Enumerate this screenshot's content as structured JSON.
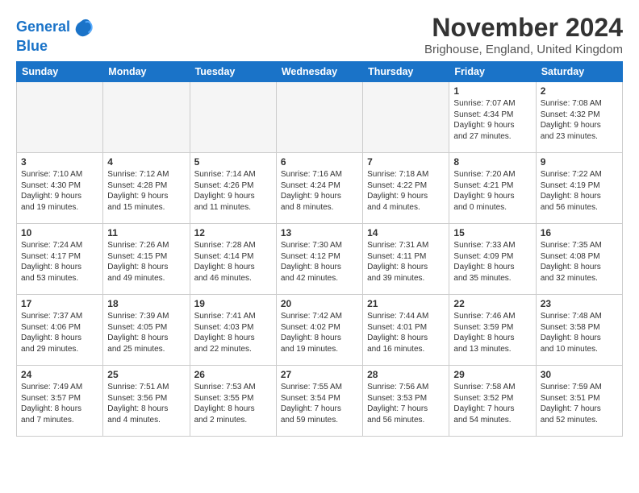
{
  "logo": {
    "line1": "General",
    "line2": "Blue",
    "icon_color": "#1a73c8"
  },
  "title": "November 2024",
  "location": "Brighouse, England, United Kingdom",
  "headers": [
    "Sunday",
    "Monday",
    "Tuesday",
    "Wednesday",
    "Thursday",
    "Friday",
    "Saturday"
  ],
  "weeks": [
    {
      "shaded": false,
      "days": [
        {
          "num": "",
          "text": "",
          "empty": true
        },
        {
          "num": "",
          "text": "",
          "empty": true
        },
        {
          "num": "",
          "text": "",
          "empty": true
        },
        {
          "num": "",
          "text": "",
          "empty": true
        },
        {
          "num": "",
          "text": "",
          "empty": true
        },
        {
          "num": "1",
          "text": "Sunrise: 7:07 AM\nSunset: 4:34 PM\nDaylight: 9 hours\nand 27 minutes.",
          "empty": false
        },
        {
          "num": "2",
          "text": "Sunrise: 7:08 AM\nSunset: 4:32 PM\nDaylight: 9 hours\nand 23 minutes.",
          "empty": false
        }
      ]
    },
    {
      "shaded": true,
      "days": [
        {
          "num": "3",
          "text": "Sunrise: 7:10 AM\nSunset: 4:30 PM\nDaylight: 9 hours\nand 19 minutes.",
          "empty": false
        },
        {
          "num": "4",
          "text": "Sunrise: 7:12 AM\nSunset: 4:28 PM\nDaylight: 9 hours\nand 15 minutes.",
          "empty": false
        },
        {
          "num": "5",
          "text": "Sunrise: 7:14 AM\nSunset: 4:26 PM\nDaylight: 9 hours\nand 11 minutes.",
          "empty": false
        },
        {
          "num": "6",
          "text": "Sunrise: 7:16 AM\nSunset: 4:24 PM\nDaylight: 9 hours\nand 8 minutes.",
          "empty": false
        },
        {
          "num": "7",
          "text": "Sunrise: 7:18 AM\nSunset: 4:22 PM\nDaylight: 9 hours\nand 4 minutes.",
          "empty": false
        },
        {
          "num": "8",
          "text": "Sunrise: 7:20 AM\nSunset: 4:21 PM\nDaylight: 9 hours\nand 0 minutes.",
          "empty": false
        },
        {
          "num": "9",
          "text": "Sunrise: 7:22 AM\nSunset: 4:19 PM\nDaylight: 8 hours\nand 56 minutes.",
          "empty": false
        }
      ]
    },
    {
      "shaded": false,
      "days": [
        {
          "num": "10",
          "text": "Sunrise: 7:24 AM\nSunset: 4:17 PM\nDaylight: 8 hours\nand 53 minutes.",
          "empty": false
        },
        {
          "num": "11",
          "text": "Sunrise: 7:26 AM\nSunset: 4:15 PM\nDaylight: 8 hours\nand 49 minutes.",
          "empty": false
        },
        {
          "num": "12",
          "text": "Sunrise: 7:28 AM\nSunset: 4:14 PM\nDaylight: 8 hours\nand 46 minutes.",
          "empty": false
        },
        {
          "num": "13",
          "text": "Sunrise: 7:30 AM\nSunset: 4:12 PM\nDaylight: 8 hours\nand 42 minutes.",
          "empty": false
        },
        {
          "num": "14",
          "text": "Sunrise: 7:31 AM\nSunset: 4:11 PM\nDaylight: 8 hours\nand 39 minutes.",
          "empty": false
        },
        {
          "num": "15",
          "text": "Sunrise: 7:33 AM\nSunset: 4:09 PM\nDaylight: 8 hours\nand 35 minutes.",
          "empty": false
        },
        {
          "num": "16",
          "text": "Sunrise: 7:35 AM\nSunset: 4:08 PM\nDaylight: 8 hours\nand 32 minutes.",
          "empty": false
        }
      ]
    },
    {
      "shaded": true,
      "days": [
        {
          "num": "17",
          "text": "Sunrise: 7:37 AM\nSunset: 4:06 PM\nDaylight: 8 hours\nand 29 minutes.",
          "empty": false
        },
        {
          "num": "18",
          "text": "Sunrise: 7:39 AM\nSunset: 4:05 PM\nDaylight: 8 hours\nand 25 minutes.",
          "empty": false
        },
        {
          "num": "19",
          "text": "Sunrise: 7:41 AM\nSunset: 4:03 PM\nDaylight: 8 hours\nand 22 minutes.",
          "empty": false
        },
        {
          "num": "20",
          "text": "Sunrise: 7:42 AM\nSunset: 4:02 PM\nDaylight: 8 hours\nand 19 minutes.",
          "empty": false
        },
        {
          "num": "21",
          "text": "Sunrise: 7:44 AM\nSunset: 4:01 PM\nDaylight: 8 hours\nand 16 minutes.",
          "empty": false
        },
        {
          "num": "22",
          "text": "Sunrise: 7:46 AM\nSunset: 3:59 PM\nDaylight: 8 hours\nand 13 minutes.",
          "empty": false
        },
        {
          "num": "23",
          "text": "Sunrise: 7:48 AM\nSunset: 3:58 PM\nDaylight: 8 hours\nand 10 minutes.",
          "empty": false
        }
      ]
    },
    {
      "shaded": false,
      "days": [
        {
          "num": "24",
          "text": "Sunrise: 7:49 AM\nSunset: 3:57 PM\nDaylight: 8 hours\nand 7 minutes.",
          "empty": false
        },
        {
          "num": "25",
          "text": "Sunrise: 7:51 AM\nSunset: 3:56 PM\nDaylight: 8 hours\nand 4 minutes.",
          "empty": false
        },
        {
          "num": "26",
          "text": "Sunrise: 7:53 AM\nSunset: 3:55 PM\nDaylight: 8 hours\nand 2 minutes.",
          "empty": false
        },
        {
          "num": "27",
          "text": "Sunrise: 7:55 AM\nSunset: 3:54 PM\nDaylight: 7 hours\nand 59 minutes.",
          "empty": false
        },
        {
          "num": "28",
          "text": "Sunrise: 7:56 AM\nSunset: 3:53 PM\nDaylight: 7 hours\nand 56 minutes.",
          "empty": false
        },
        {
          "num": "29",
          "text": "Sunrise: 7:58 AM\nSunset: 3:52 PM\nDaylight: 7 hours\nand 54 minutes.",
          "empty": false
        },
        {
          "num": "30",
          "text": "Sunrise: 7:59 AM\nSunset: 3:51 PM\nDaylight: 7 hours\nand 52 minutes.",
          "empty": false
        }
      ]
    }
  ]
}
